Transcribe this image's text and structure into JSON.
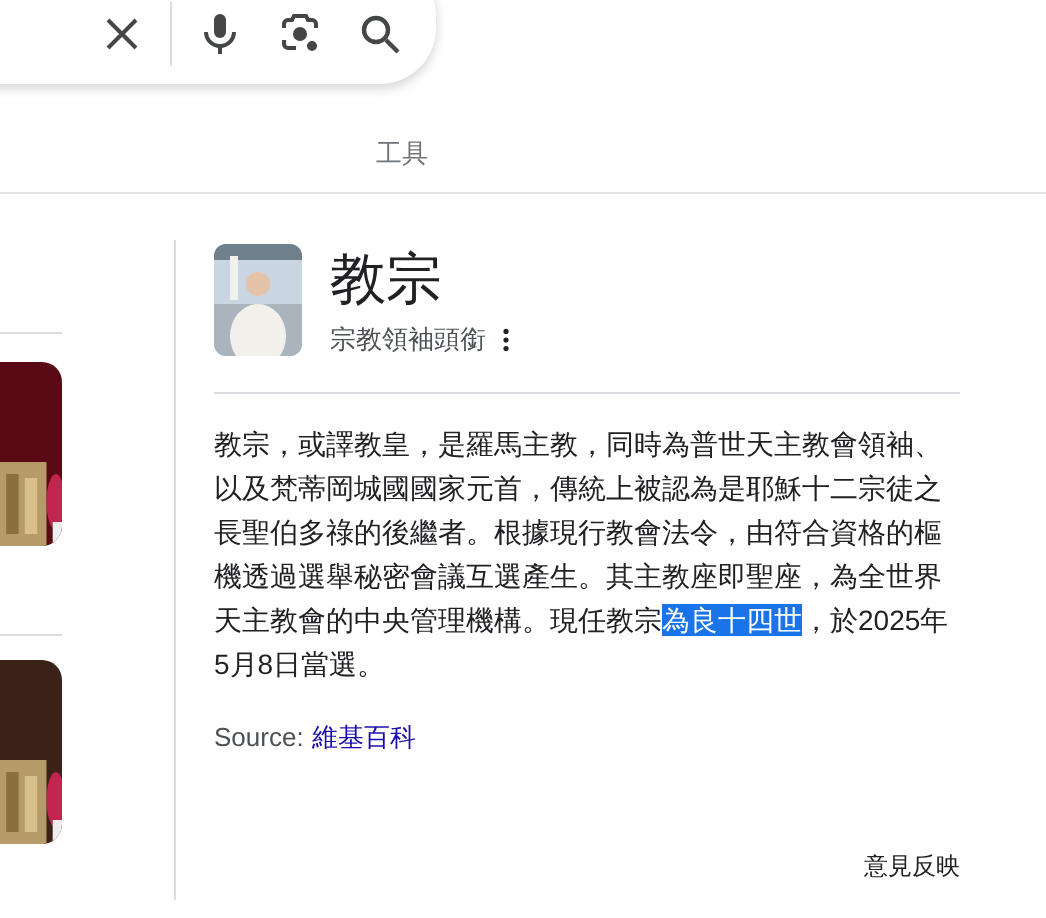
{
  "search_bar": {
    "buttons": [
      {
        "kind": "clear"
      },
      {
        "kind": "voice"
      },
      {
        "kind": "lens"
      },
      {
        "kind": "search"
      }
    ]
  },
  "tools_tab": {
    "label": "工具"
  },
  "knowledge_panel": {
    "title": "教宗",
    "subtitle": "宗教領袖頭銜",
    "description": [
      {
        "text": "教宗，或譯教皇，是羅馬主教，同時為普世天主教會領袖、以及梵蒂岡城國國家元首，傳統上被認為是耶穌十二宗徒之長聖伯多祿的後繼者。根據現行教會法令，由符合資格的樞機透過選舉秘密會議互選產生。其主教座即聖座，為全世界天主教會的中央管理機構。現任教宗",
        "selected": false
      },
      {
        "text": "為良十四世",
        "selected": true
      },
      {
        "text": "，於2025年5月8日當選。",
        "selected": false
      }
    ],
    "source_label": "Source:",
    "source_link": "維基百科"
  },
  "feedback": "意見反映"
}
